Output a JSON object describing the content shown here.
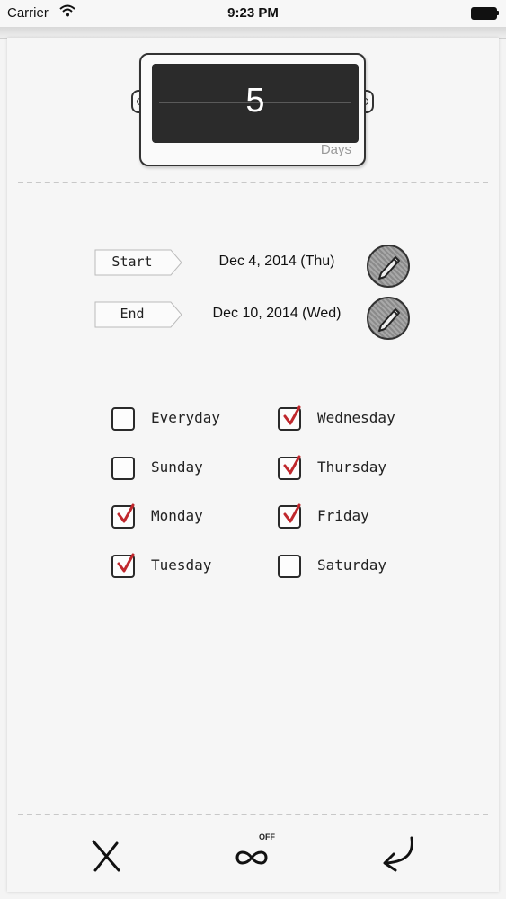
{
  "status_bar": {
    "carrier": "Carrier",
    "time": "9:23 PM"
  },
  "counter": {
    "value": "5",
    "unit": "Days"
  },
  "dates": [
    {
      "tag": "Start",
      "value": "Dec 4, 2014 (Thu)"
    },
    {
      "tag": "End",
      "value": "Dec 10, 2014 (Wed)"
    }
  ],
  "days": {
    "left": [
      {
        "label": "Everyday",
        "checked": false
      },
      {
        "label": "Sunday",
        "checked": false
      },
      {
        "label": "Monday",
        "checked": true
      },
      {
        "label": "Tuesday",
        "checked": true
      }
    ],
    "right": [
      {
        "label": "Wednesday",
        "checked": true
      },
      {
        "label": "Thursday",
        "checked": true
      },
      {
        "label": "Friday",
        "checked": true
      },
      {
        "label": "Saturday",
        "checked": false
      }
    ]
  },
  "toolbar": {
    "infinity_state": "OFF"
  },
  "icons": [
    "wifi-icon",
    "battery-icon",
    "pencil-icon",
    "close-icon",
    "infinity-icon",
    "return-icon"
  ],
  "colors": {
    "check": "#c0282d",
    "ink": "#222222",
    "counter_bg": "#2b2b2b"
  }
}
